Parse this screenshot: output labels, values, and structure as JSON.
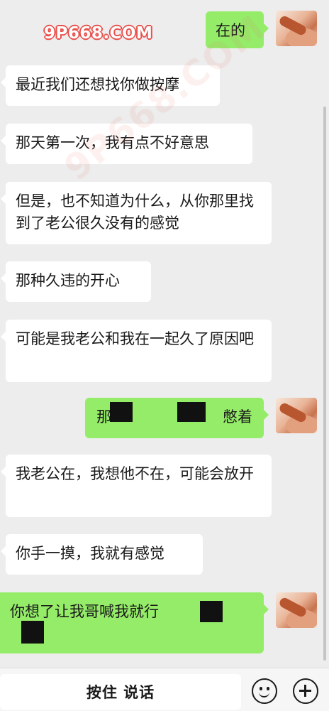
{
  "watermark": {
    "text": "9P668.COM",
    "diagonal": "9P668.COM"
  },
  "messages": [
    {
      "side": "out",
      "text": "在的"
    },
    {
      "side": "in",
      "text": "最近我们还想找你做按摩"
    },
    {
      "side": "in",
      "text": "那天第一次，我有点不好意思"
    },
    {
      "side": "in",
      "text": "但是，也不知道为什么，从你那里找到了老公很久没有的感觉"
    },
    {
      "side": "in",
      "text": "那种久违的开心"
    },
    {
      "side": "in",
      "text": "可能是我老公和我在一起久了原因吧"
    },
    {
      "side": "out",
      "text_start": "那",
      "text_end": "憋着"
    },
    {
      "side": "in",
      "text": "我老公在，我想他不在，可能会放开"
    },
    {
      "side": "in",
      "text": "你手一摸，我就有感觉"
    },
    {
      "side": "out",
      "text": "你想了让我哥喊我就行"
    }
  ],
  "input_bar": {
    "talk_label": "按住 说话",
    "emoji_icon": "emoji-icon",
    "plus_icon": "plus-icon"
  },
  "colors": {
    "background": "#ededed",
    "outgoing_bubble": "#95ec69",
    "incoming_bubble": "#ffffff"
  }
}
